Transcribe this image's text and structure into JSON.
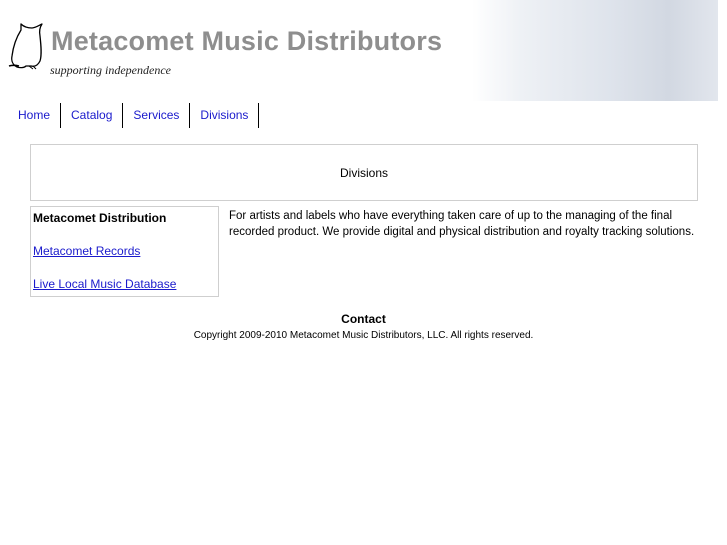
{
  "header": {
    "site_title": "Metacomet Music Distributors",
    "tagline": "supporting independence"
  },
  "nav": {
    "items": [
      {
        "label": "Home"
      },
      {
        "label": "Catalog"
      },
      {
        "label": "Services"
      },
      {
        "label": "Divisions"
      }
    ]
  },
  "section": {
    "title": "Divisions"
  },
  "sidebar": {
    "current": "Metacomet Distribution",
    "links": [
      {
        "label": "Metacomet Records"
      },
      {
        "label": "Live Local Music Database"
      }
    ]
  },
  "main": {
    "description": "For artists and labels who have everything taken care of up to the managing of the final recorded product.  We provide digital and physical distribution and royalty tracking solutions."
  },
  "footer": {
    "contact": "Contact",
    "copyright": "Copyright 2009-2010 Metacomet Music Distributors, LLC. All rights reserved."
  },
  "colors": {
    "link": "#1a1acc",
    "title_gray": "#8e8e8e",
    "border": "#cfcfcf"
  },
  "icons": {
    "logo": "owl-logo-icon"
  }
}
